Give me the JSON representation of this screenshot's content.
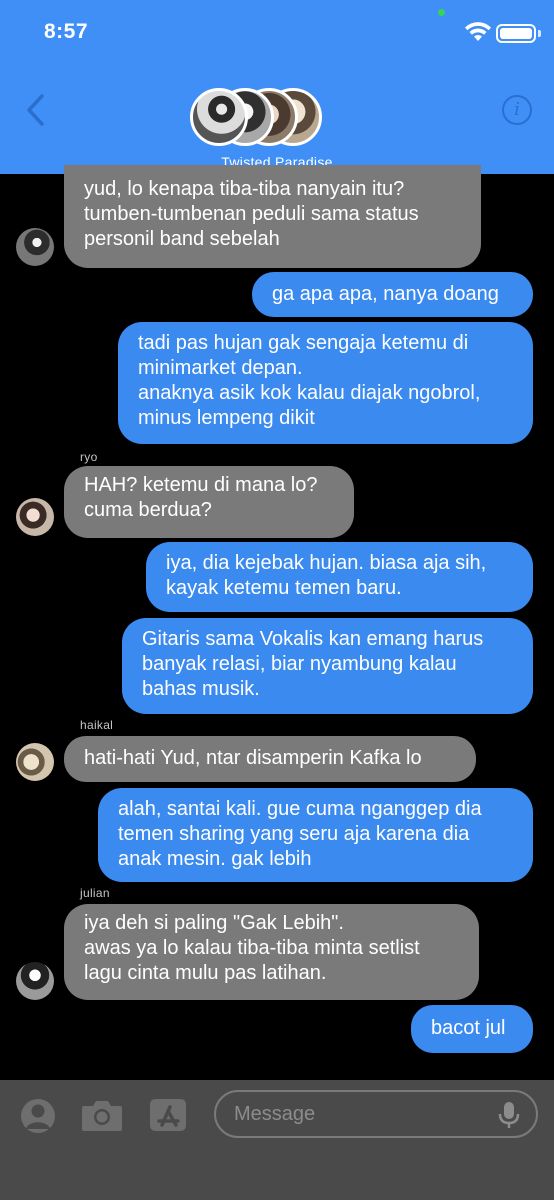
{
  "status_bar": {
    "time": "8:57"
  },
  "header": {
    "group_name": "Twisted Paradise",
    "info_glyph": "i"
  },
  "messages": [
    {
      "lines": [
        "yud, lo kenapa tiba-tiba nanyain itu?",
        "tumben-tumbenan peduli sama status",
        "personil band sebelah"
      ]
    },
    {
      "lines": [
        "ga apa apa, nanya doang"
      ]
    },
    {
      "lines": [
        "tadi pas hujan gak sengaja ketemu di",
        "minimarket depan.",
        "anaknya asik kok kalau diajak ngobrol,",
        "minus lempeng dikit"
      ]
    },
    {
      "sender": "ryo",
      "lines": [
        "HAH? ketemu di mana lo?",
        "cuma berdua?"
      ]
    },
    {
      "lines": [
        "iya, dia kejebak hujan. biasa aja sih,",
        "kayak ketemu temen baru."
      ]
    },
    {
      "lines": [
        "Gitaris sama Vokalis kan emang harus",
        "banyak relasi, biar nyambung kalau",
        "bahas musik."
      ]
    },
    {
      "sender": "haikal",
      "lines": [
        "hati-hati Yud, ntar disamperin Kafka lo"
      ]
    },
    {
      "lines": [
        "alah, santai kali. gue cuma nganggep dia",
        "temen sharing yang seru aja karena dia",
        "anak mesin. gak lebih"
      ]
    },
    {
      "sender": "julian",
      "lines": [
        "iya deh si paling \"Gak Lebih\".",
        "awas ya lo kalau tiba-tiba minta setlist",
        "lagu cinta mulu pas latihan."
      ]
    },
    {
      "lines": [
        "bacot jul"
      ]
    }
  ],
  "composer": {
    "placeholder": "Message"
  },
  "icons": {
    "back": "chevron-left-icon",
    "info": "info-icon",
    "contact": "contact-icon",
    "camera": "camera-icon",
    "app_store": "app-store-icon",
    "mic": "microphone-icon"
  },
  "colors": {
    "header_bg": "#3F8FF7",
    "incoming_bubble": "#7A7A7A",
    "outgoing_bubble": "#3B8AF0",
    "background": "#000000",
    "bottom_bar": "#4A4A4A"
  }
}
